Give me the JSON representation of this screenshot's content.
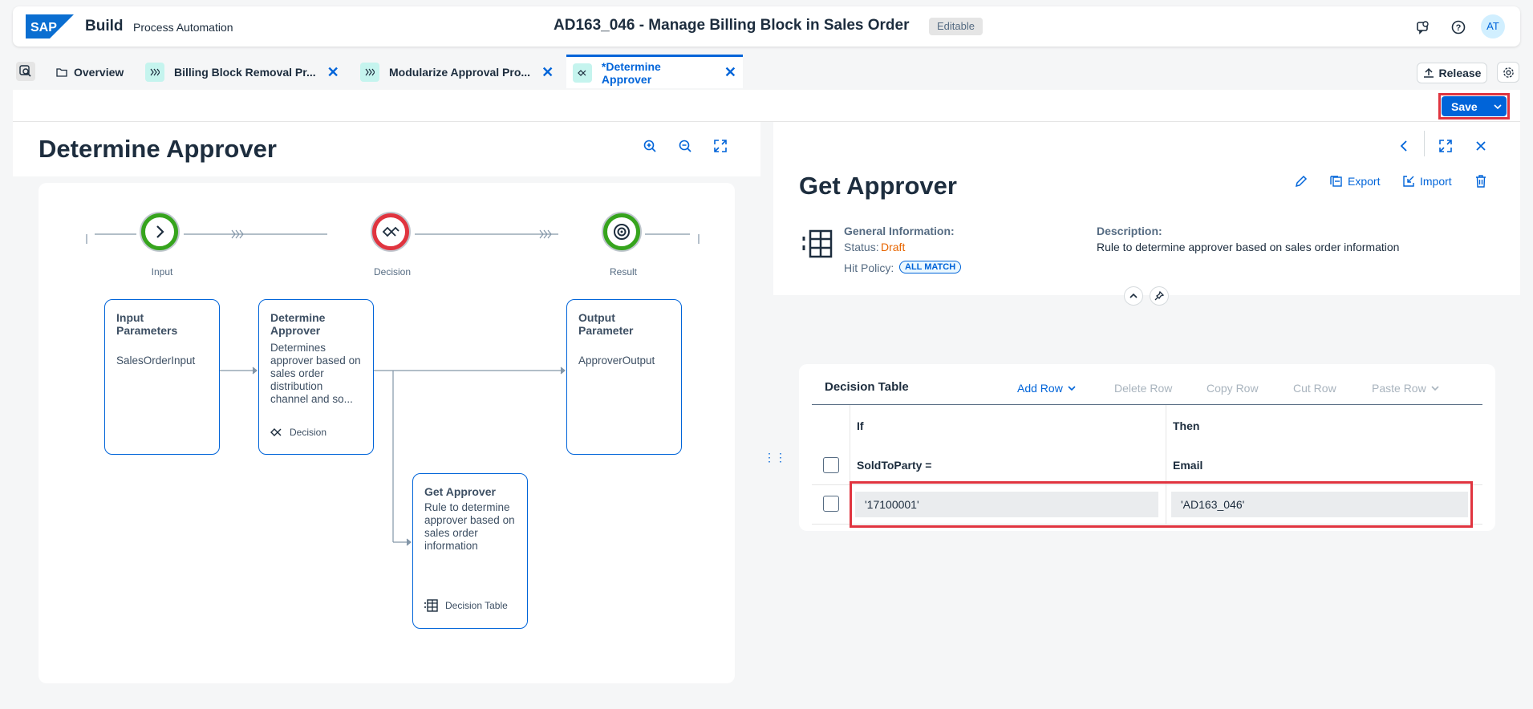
{
  "shell": {
    "brand": "Build",
    "product": "Process Automation",
    "title": "AD163_046 - Manage Billing Block in Sales Order",
    "badge": "Editable",
    "avatar": "AT",
    "icons": [
      "sap-logo",
      "chat-icon",
      "help-icon"
    ]
  },
  "tabs": [
    {
      "label": "Overview",
      "icon": "folder-icon"
    },
    {
      "label": "Billing Block Removal Pr...",
      "icon": "process-icon"
    },
    {
      "label": "Modularize Approval Pro...",
      "icon": "process-icon"
    },
    {
      "label": "*Determine Approver",
      "icon": "decision-icon",
      "active": true
    }
  ],
  "toolbar": {
    "release": "Release",
    "save": "Save"
  },
  "left": {
    "title": "Determine Approver",
    "flow": {
      "nodes": [
        "Input",
        "Decision",
        "Result"
      ]
    },
    "cards": [
      {
        "title": "Input Parameters",
        "desc": "SalesOrderInput"
      },
      {
        "title": "Determine Approver",
        "desc": "Determines approver based on sales order distribution channel and so...",
        "foot": "Decision"
      },
      {
        "title": "Output Parameter",
        "desc": "ApproverOutput"
      },
      {
        "title": "Get Approver",
        "desc": "Rule to determine approver based on sales order information",
        "foot": "Decision Table"
      }
    ]
  },
  "right": {
    "title": "Get Approver",
    "actions": {
      "export": "Export",
      "import": "Import"
    },
    "info": {
      "general_label": "General Information:",
      "status_label": "Status:",
      "status_value": "Draft",
      "hit_label": "Hit Policy:",
      "hit_value": "ALL MATCH",
      "desc_label": "Description:",
      "desc_value": "Rule to determine approver based on sales order information"
    }
  },
  "decision_table": {
    "title": "Decision Table",
    "actions": [
      "Add Row",
      "Delete Row",
      "Copy Row",
      "Cut Row",
      "Paste Row"
    ],
    "groups": [
      "If",
      "Then"
    ],
    "columns": [
      "SoldToParty =",
      "Email"
    ],
    "rows": [
      [
        "'17100001'",
        "'AD163_046'"
      ]
    ]
  },
  "colors": {
    "accent": "#0064d9",
    "positive": "#36a41d",
    "negative": "#e0343f",
    "draft": "#e76500"
  }
}
